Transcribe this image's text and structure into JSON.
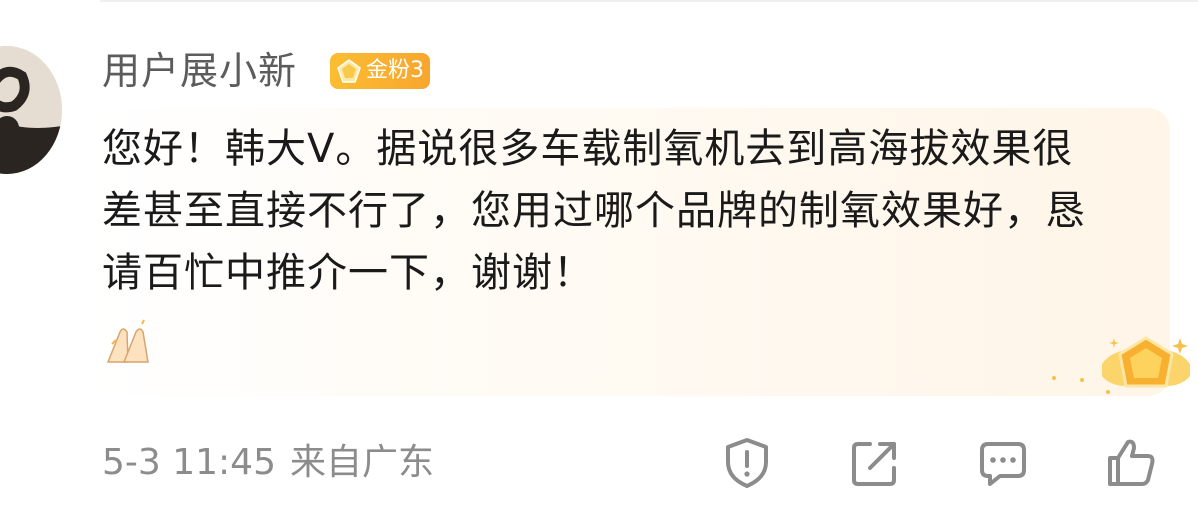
{
  "comment": {
    "username": "用户展小新",
    "fan_badge": {
      "label": "金粉3",
      "icon": "diamond-icon",
      "color": "#f8a62e"
    },
    "text": "您好！韩大V。据说很多车载制氧机去到高海拔效果很差甚至直接不行了，您用过哪个品牌的制氧效果好，恳请百忙中推介一下，谢谢！",
    "emoji": "clapping-hands-emoji",
    "timestamp": "5-3 11:45",
    "location": "来自广东",
    "actions": [
      {
        "icon": "report-shield-icon"
      },
      {
        "icon": "share-icon"
      },
      {
        "icon": "comment-icon"
      },
      {
        "icon": "like-thumb-icon"
      }
    ]
  },
  "colors": {
    "username": "#5c5c5c",
    "text": "#1a1a1a",
    "meta": "#8c8c8c",
    "bubble": "#fff5e8",
    "badge": "#fbbd33"
  }
}
